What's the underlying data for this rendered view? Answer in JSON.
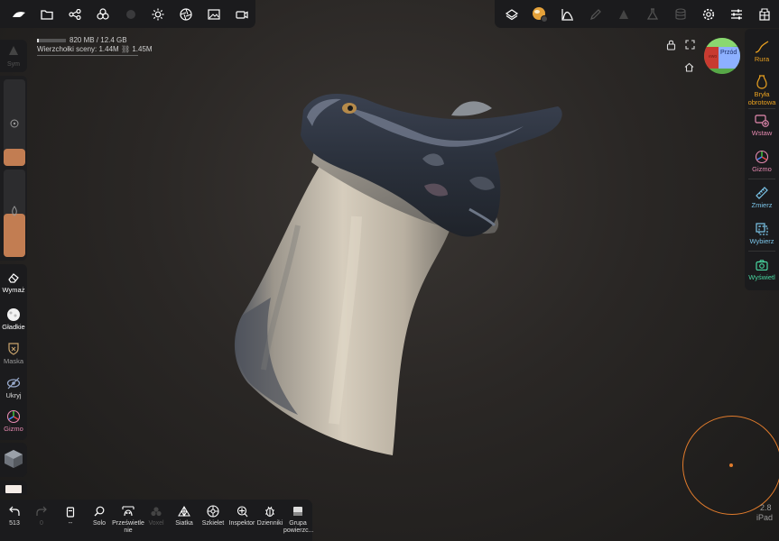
{
  "top_left_bar": {
    "icons": [
      "logo-icon",
      "folder-icon",
      "scene-tree-icon",
      "tools-icon",
      "material-icon",
      "light-icon",
      "aperture-icon",
      "image-icon",
      "camera-icon"
    ]
  },
  "top_right_bar": {
    "icons": [
      "layers-icon",
      "matcap-icon",
      "stroke-curve-icon",
      "pen-icon",
      "pyramid-icon",
      "flask-icon",
      "stack-icon",
      "settings-icon",
      "sliders-icon",
      "user-icon"
    ]
  },
  "stats": {
    "memory": "820 MB / 12.4 GB",
    "memory_fraction": 0.066,
    "vertices_label": "Wierzchołki sceny:",
    "vertices_value": "1.44M",
    "vertices_value2": "1.45M"
  },
  "left_panel": {
    "sym_label": "Sym",
    "radius_fill": 0.2,
    "intensity_fill": 0.5,
    "tools": [
      {
        "label": "Wymaż",
        "icon": "eraser-icon"
      },
      {
        "label": "Gładkie",
        "icon": "smooth-icon"
      },
      {
        "label": "Maska",
        "icon": "mask-icon"
      },
      {
        "label": "Ukryj",
        "icon": "hide-icon"
      },
      {
        "label": "Gizmo",
        "icon": "gizmo-icon"
      }
    ]
  },
  "right_panel": {
    "tools": [
      {
        "label": "Rura",
        "icon": "tube-icon"
      },
      {
        "label": "Bryła obrotowa",
        "icon": "lathe-icon"
      },
      {
        "label": "Wstaw",
        "icon": "insert-icon"
      },
      {
        "label": "Gizmo",
        "icon": "gizmo-icon"
      },
      {
        "label": "Zmierz",
        "icon": "ruler-icon"
      },
      {
        "label": "Wybierz",
        "icon": "select-icon"
      },
      {
        "label": "Wyświetl",
        "icon": "view-icon"
      }
    ]
  },
  "orientation_cube": {
    "front_label": "Przód"
  },
  "bottom_bar": {
    "buttons": [
      {
        "label": "513",
        "icon": "undo-icon"
      },
      {
        "label": "0",
        "icon": "redo-icon"
      },
      {
        "label": "--",
        "icon": "trash-icon"
      },
      {
        "label": "Solo",
        "icon": "search-icon"
      },
      {
        "label": "Prześwietlenie",
        "icon": "xray-icon"
      },
      {
        "label": "Voxel",
        "icon": "voxel-icon"
      },
      {
        "label": "Siatka",
        "icon": "wireframe-icon"
      },
      {
        "label": "Szkielet",
        "icon": "skeleton-icon"
      },
      {
        "label": "Inspektor",
        "icon": "inspector-icon"
      },
      {
        "label": "Dzienniki",
        "icon": "bug-icon"
      },
      {
        "label": "Grupa powierzc...",
        "icon": "surface-group-icon"
      }
    ]
  },
  "colors": {
    "accent_orange": "#e8a020",
    "accent_pink": "#e58ab0",
    "accent_blue": "#7cc6ea",
    "accent_green": "#48d6a0",
    "brush_orange": "#e07b2c",
    "slider_fill": "#c27d52"
  },
  "version": {
    "number": "2.8",
    "device": "iPad"
  }
}
